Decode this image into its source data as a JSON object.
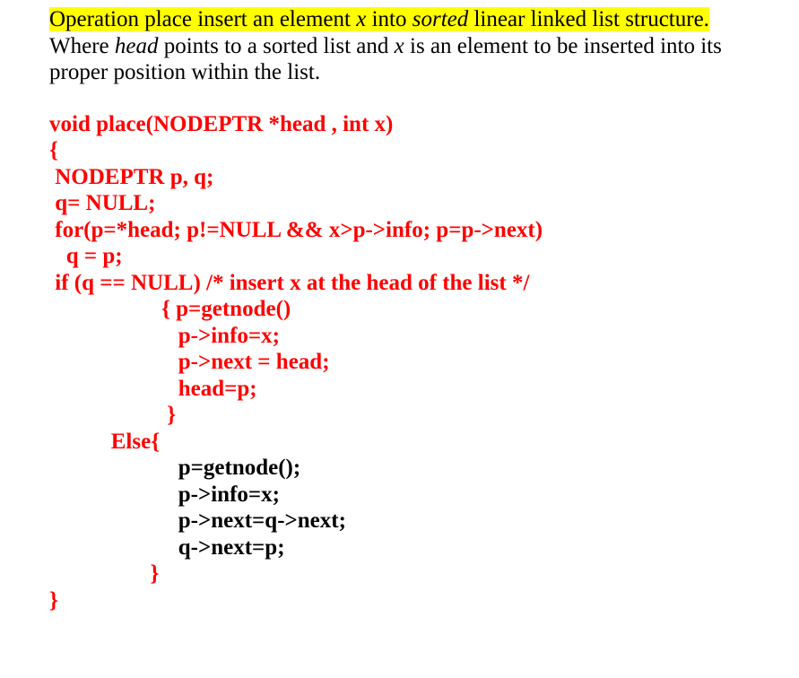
{
  "intro": {
    "hl_pre": "Operation place insert an element ",
    "hl_x": "x",
    "hl_mid": " into ",
    "hl_sorted": "sorted",
    "hl_post": " linear linked list structure.",
    "plain_pre": "Where ",
    "plain_head": "head",
    "plain_mid1": " points to a sorted list and ",
    "plain_x": "x",
    "plain_mid2": " is an element to be inserted into its proper position within the list."
  },
  "code": {
    "l01": "void place(NODEPTR *head , int x)",
    "l02": "{",
    "l03": " NODEPTR p, q;",
    "l04": " q= NULL;",
    "l05": " for(p=*head; p!=NULL && x>p->info; p=p->next)",
    "l06": "   q = p;",
    "l07": " if (q == NULL) /* insert x at the head of the list */",
    "l08": "                    { p=getnode()",
    "l09": "                       p->info=x;",
    "l10": "                       p->next = head;",
    "l11": "                       head=p;",
    "l12": "                     }",
    "l13": "           Else{",
    "l14": "                       p=getnode();",
    "l15": "                       p->info=x;",
    "l16": "                       p->next=q->next;",
    "l17": "                       q->next=p;",
    "l18": "                  }",
    "l19": "}"
  }
}
